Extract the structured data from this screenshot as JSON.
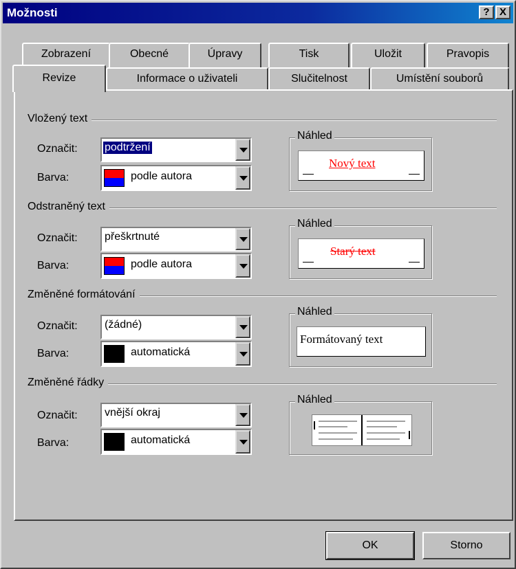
{
  "window": {
    "title": "Možnosti",
    "help_label": "?",
    "close_label": "X"
  },
  "tabs_back": [
    {
      "label": "Zobrazení"
    },
    {
      "label": "Obecné"
    },
    {
      "label": "Úpravy"
    },
    {
      "label": "Tisk"
    },
    {
      "label": "Uložit"
    },
    {
      "label": "Pravopis"
    }
  ],
  "tabs_front": [
    {
      "label": "Revize",
      "active": true
    },
    {
      "label": "Informace o uživateli"
    },
    {
      "label": "Slučitelnost"
    },
    {
      "label": "Umístění souborů"
    }
  ],
  "labels": {
    "mark": "Označit:",
    "color": "Barva:",
    "preview": "Náhled"
  },
  "groups": [
    {
      "title": "Vložený text",
      "mark_value": "podtržení",
      "color_value": "podle autora",
      "swatch": "author",
      "preview_text": "Nový text",
      "preview_color": "#ff0000"
    },
    {
      "title": "Odstraněný text",
      "mark_value": "přeškrtnuté",
      "color_value": "podle autora",
      "swatch": "author",
      "preview_text": "Starý text",
      "preview_color": "#ff0000"
    },
    {
      "title": "Změněné formátování",
      "mark_value": "(žádné)",
      "color_value": "automatická",
      "swatch": "black",
      "preview_text": "Formátovaný text"
    },
    {
      "title": "Změněné řádky",
      "mark_value": "vnější okraj",
      "color_value": "automatická",
      "swatch": "black",
      "preview_icon": "changed-lines-preview-icon"
    }
  ],
  "buttons": {
    "ok": "OK",
    "cancel": "Storno"
  },
  "colors": {
    "title_bar": "#000080",
    "face": "#c0c0c0",
    "author_swatch_top": "#ff0000",
    "author_swatch_bottom": "#0000ff",
    "black_swatch": "#000000"
  }
}
